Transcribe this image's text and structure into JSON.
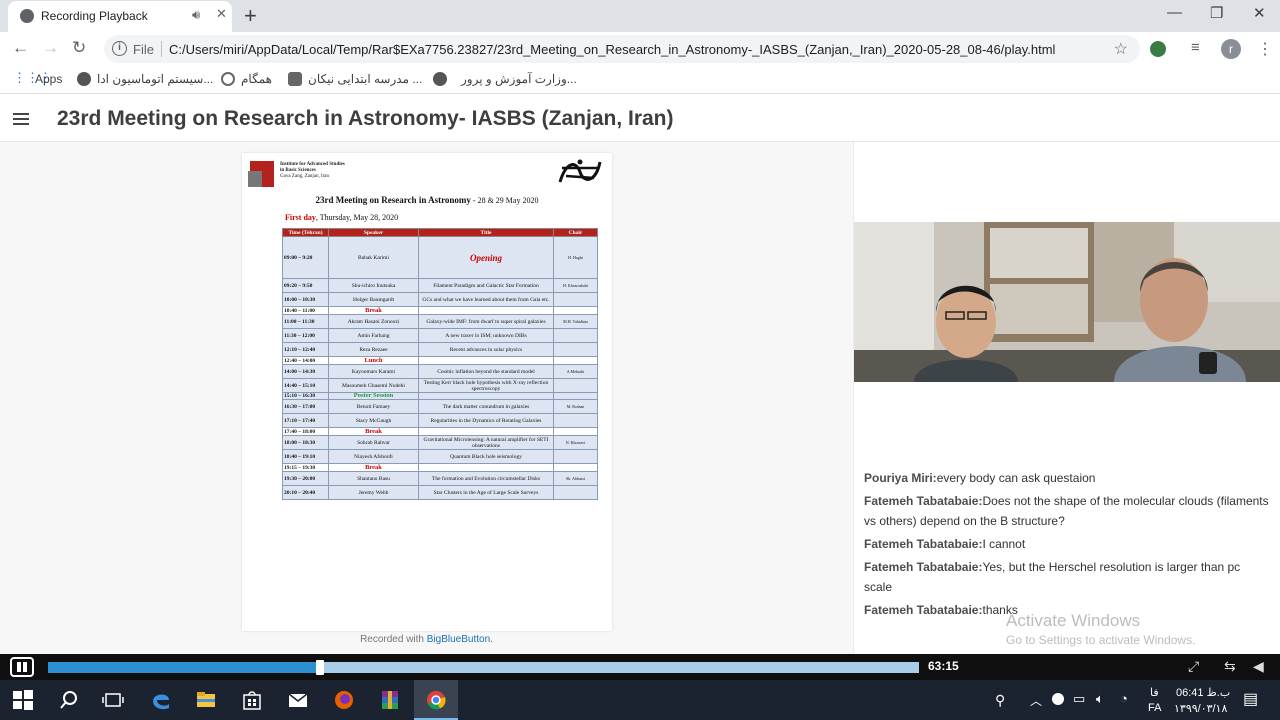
{
  "browser": {
    "tab_title": "Recording Playback",
    "new_tab": "+",
    "url_scheme": "File",
    "url": "C:/Users/miri/AppData/Local/Temp/Rar$EXa7756.23827/23rd_Meeting_on_Research_in_Astronomy-_IASBS_(Zanjan,_Iran)_2020-05-28_08-46/play.html",
    "profile_initial": "r",
    "bookmarks": [
      {
        "label": "Apps"
      },
      {
        "label": "سیستم اتوماسیون ادا..."
      },
      {
        "label": "همگام"
      },
      {
        "label": "مدرسه ابتدایی نیکان ..."
      },
      {
        "label": "وزارت آموزش و پرور..."
      }
    ]
  },
  "page": {
    "title": "23rd Meeting on Research in Astronomy- IASBS (Zanjan, Iran)",
    "recorded_with": "Recorded with",
    "recorded_link": "BigBlueButton."
  },
  "slide": {
    "institute": [
      "Institute for Advanced Studies",
      "in Basic Sciences",
      "Gava Zang, Zanjan, Iran"
    ],
    "title": "23rd Meeting on Research in Astronomy",
    "title_dates": " - 28 & 29 May 2020",
    "day_label": "First day",
    "day_date": ", Thursday, May 28, 2020",
    "headers": [
      "Time (Tehran)",
      "Speaker",
      "Title",
      "Chair"
    ],
    "opening": "Opening",
    "rows": [
      {
        "time": "09:00 – 9:20",
        "speaker": "Babak Karimi",
        "title": "",
        "chair": "H. Haghi"
      },
      {
        "time": "09:20 – 9:50",
        "speaker": "Shu-ichiro Inutsuka",
        "title": "Filament Paradigm and Galactic Star Formation",
        "chair": "H. Khosroshahi"
      },
      {
        "time": "10:00 – 10:30",
        "speaker": "Holger Baumgardt",
        "title": "GCs and what we have learned about them from Gaia etc.",
        "chair": ""
      },
      {
        "time": "10:40 – 11:00",
        "break": "Break"
      },
      {
        "time": "11:00 – 11:30",
        "speaker": "Akram Hasani Zonoozi",
        "title": "Galaxy-wide IMF: from dwarf to super spiral galaxies",
        "chair": "M.H. Vahidinia"
      },
      {
        "time": "11:30 – 12:00",
        "speaker": "Amin Farhang",
        "title": "A new tracer in ISM; unknown DIBs",
        "chair": ""
      },
      {
        "time": "12:10 – 12:40",
        "speaker": "Reza Rezaee",
        "title": "Recent advances in solar physics",
        "chair": ""
      },
      {
        "time": "12:40 – 14:00",
        "break": "Lunch"
      },
      {
        "time": "14:00 – 14:30",
        "speaker": "Kayoomars Karami",
        "title": "Cosmic inflation beyond the standard model",
        "chair": "A.Mehrabi"
      },
      {
        "time": "14:40 – 15:10",
        "speaker": "Masoumeh Ghasemi Nodehi",
        "title": "Testing Kerr black hole hypothesis with X-ray reflection spectroscopy",
        "chair": ""
      },
      {
        "time": "15:10 – 16:30",
        "poster": "Poster Session"
      },
      {
        "time": "16:30 – 17:00",
        "speaker": "Benoit Famaey",
        "title": "The dark matter conundrum in galaxies",
        "chair": "M. Roshan"
      },
      {
        "time": "17:10 – 17:40",
        "speaker": "Stacy McGaugh",
        "title": "Regularities in the Dynamics of Rotating Galaxies",
        "chair": ""
      },
      {
        "time": "17:40 – 18:00",
        "break": "Break"
      },
      {
        "time": "18:00 – 18:30",
        "speaker": "Sohrab Rahvar",
        "title": "Gravitational Microlensing: A natural amplifier for SETI observations",
        "chair": "N. Khosravi"
      },
      {
        "time": "18:40 – 19:10",
        "speaker": "Niayesh Afshordi",
        "title": "Quantum Black hole seismology",
        "chair": ""
      },
      {
        "time": "19:15 – 19:30",
        "break": "Break"
      },
      {
        "time": "19:30 – 20:00",
        "speaker": "Shantanu Basu",
        "title": "The formation and Evolution circumstellar Disks",
        "chair": "Sh. Abbassi"
      },
      {
        "time": "20:10 – 20:40",
        "speaker": "Jeremy Webb",
        "title": "Star Clusters in the Age of Large Scale Surveys",
        "chair": ""
      }
    ]
  },
  "chat": [
    {
      "who": "Pouriya Miri:",
      "text": "every body can ask questaion"
    },
    {
      "who": "Fatemeh Tabatabaie:",
      "text": "Does not the shape of the molecular clouds (filaments vs others) depend on the B structure?"
    },
    {
      "who": "Fatemeh Tabatabaie:",
      "text": "I cannot"
    },
    {
      "who": "Fatemeh Tabatabaie:",
      "text": "Yes, but the Herschel resolution is larger than pc scale"
    },
    {
      "who": "Fatemeh Tabatabaie:",
      "text": "thanks"
    }
  ],
  "watermark": {
    "line1": "Activate Windows",
    "line2": "Go to Settings to activate Windows."
  },
  "player": {
    "timestamp": "63:15",
    "progress_fraction": 0.31
  },
  "taskbar": {
    "lang": "FA",
    "lang_top": "فا",
    "time": "06:41 ب.ظ",
    "date": "۱۳۹۹/۰۳/۱۸"
  },
  "colors": {
    "accent": "#2a8fd1",
    "slide_header": "#b3221c",
    "taskbar": "#1c2330"
  }
}
